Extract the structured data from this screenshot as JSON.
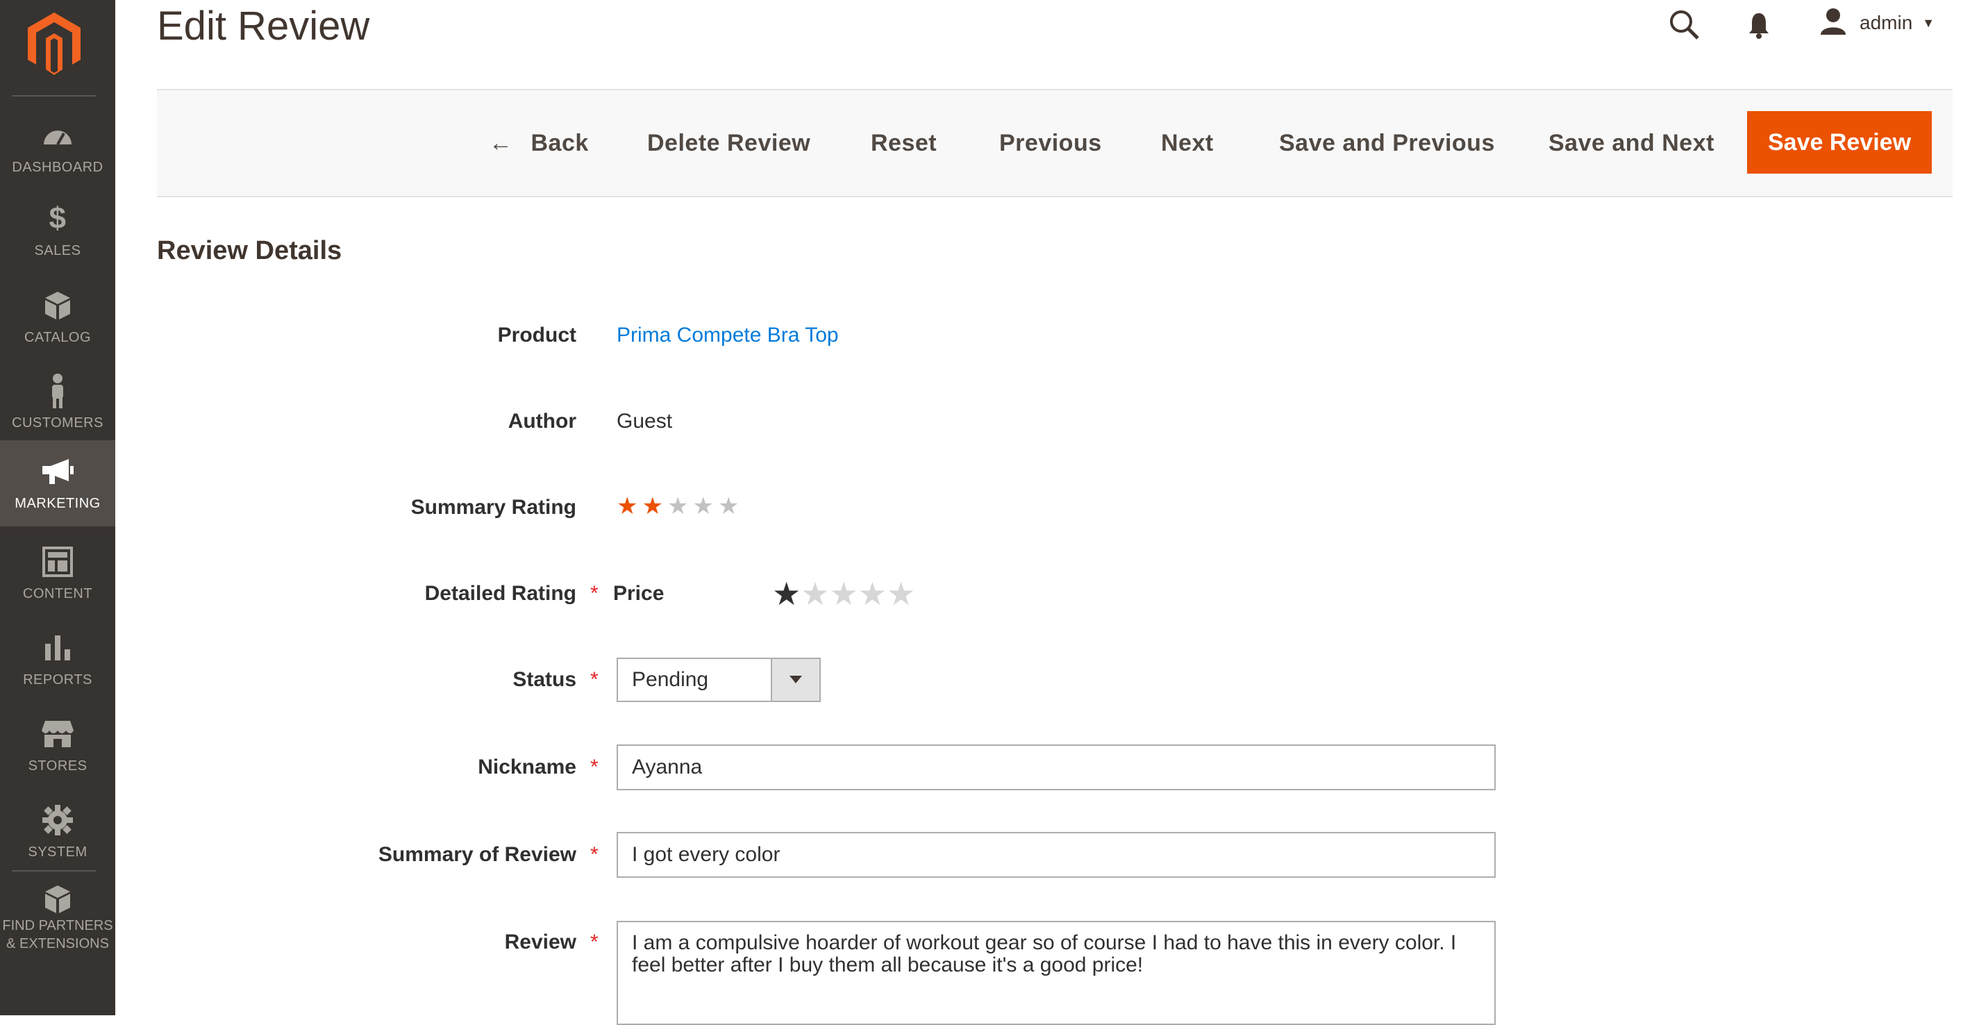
{
  "header": {
    "title": "Edit Review",
    "user_name": "admin"
  },
  "sidebar": {
    "items": [
      {
        "label": "DASHBOARD",
        "icon": "dashboard-icon"
      },
      {
        "label": "SALES",
        "icon": "dollar-icon"
      },
      {
        "label": "CATALOG",
        "icon": "box-icon"
      },
      {
        "label": "CUSTOMERS",
        "icon": "person-icon"
      },
      {
        "label": "MARKETING",
        "icon": "megaphone-icon",
        "active": true
      },
      {
        "label": "CONTENT",
        "icon": "layout-icon"
      },
      {
        "label": "REPORTS",
        "icon": "bar-chart-icon"
      },
      {
        "label": "STORES",
        "icon": "storefront-icon"
      },
      {
        "label": "SYSTEM",
        "icon": "gear-icon"
      }
    ],
    "partners_line1": "FIND PARTNERS",
    "partners_line2": "& EXTENSIONS"
  },
  "toolbar": {
    "back": "Back",
    "delete": "Delete Review",
    "reset": "Reset",
    "previous": "Previous",
    "next": "Next",
    "save_previous": "Save and Previous",
    "save_next": "Save and Next",
    "save_review": "Save Review"
  },
  "form": {
    "section_title": "Review Details",
    "product_label": "Product",
    "product_value": "Prima Compete Bra Top",
    "author_label": "Author",
    "author_value": "Guest",
    "summary_rating_label": "Summary Rating",
    "summary_rating_value": 2,
    "summary_rating_max": 5,
    "detailed_rating_label": "Detailed Rating",
    "detailed_rating_item": "Price",
    "detailed_rating_value": 1,
    "status_label": "Status",
    "status_value": "Pending",
    "nickname_label": "Nickname",
    "nickname_value": "Ayanna",
    "summary_label": "Summary of Review",
    "summary_value": "I got every color",
    "review_label": "Review",
    "review_value": "I am a compulsive hoarder of workout gear so of course I had to have this in every color. I feel better after I buy them all because it's a good price!"
  },
  "colors": {
    "sidebar_bg": "#373330",
    "sidebar_active": "#524d49",
    "accent": "#eb5202",
    "link": "#007bdb",
    "required": "#e22626"
  }
}
